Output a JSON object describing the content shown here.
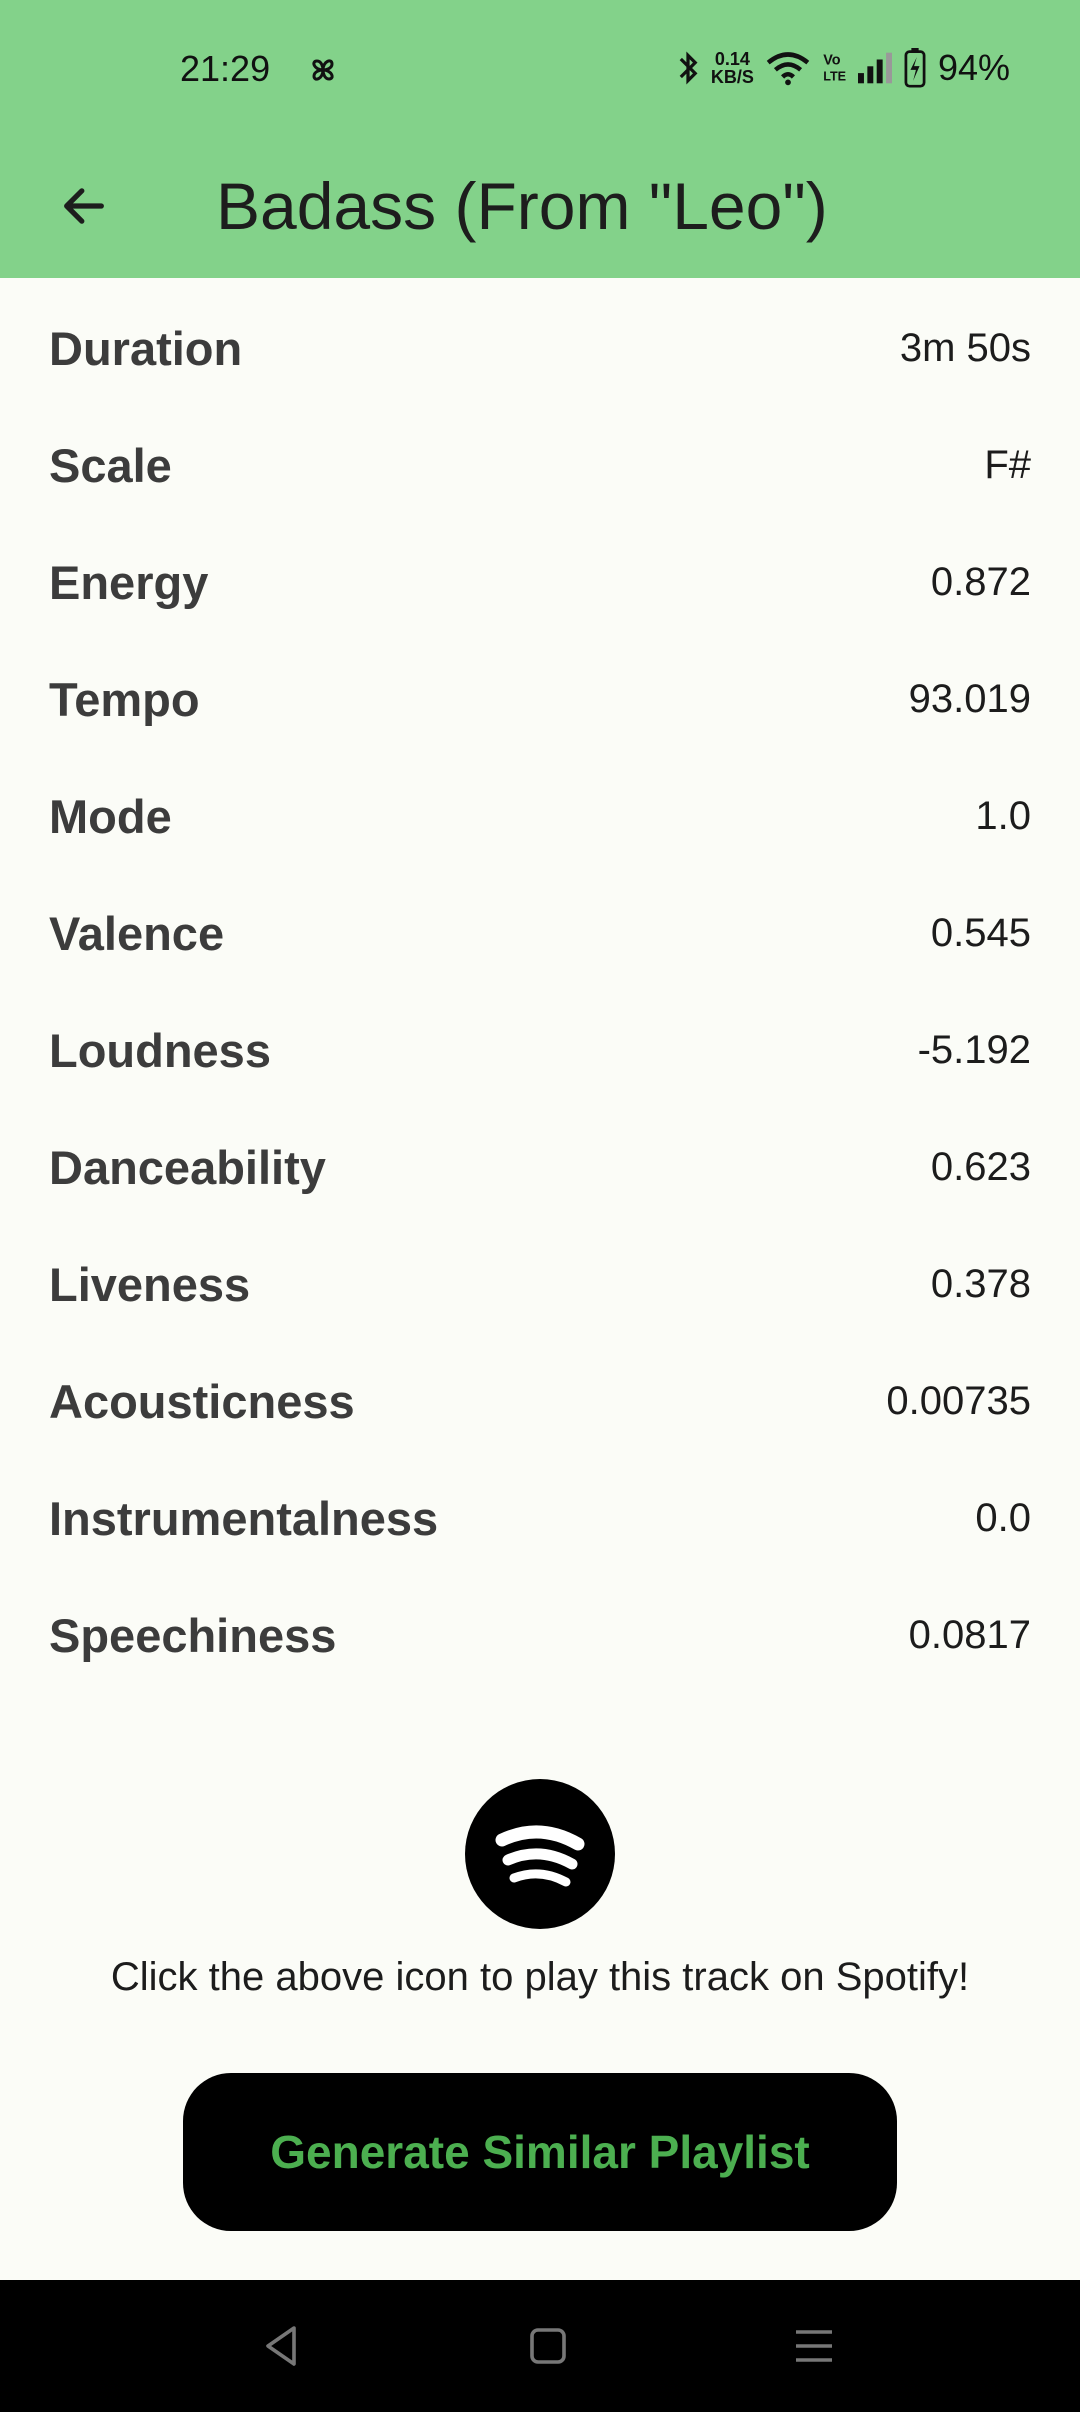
{
  "status_bar": {
    "time": "21:29",
    "net_speed_value": "0.14",
    "net_speed_unit": "KB/S",
    "battery": "94%",
    "icons": [
      "pinwheel-icon",
      "bluetooth-icon",
      "wifi-icon",
      "volte-icon",
      "signal-icon",
      "battery-icon"
    ]
  },
  "app_bar": {
    "title": "Badass (From \"Leo\")",
    "back_icon": "arrow-back-icon"
  },
  "features": [
    {
      "label": "Duration",
      "value": "3m 50s"
    },
    {
      "label": "Scale",
      "value": "F#"
    },
    {
      "label": "Energy",
      "value": "0.872"
    },
    {
      "label": "Tempo",
      "value": "93.019"
    },
    {
      "label": "Mode",
      "value": "1.0"
    },
    {
      "label": "Valence",
      "value": "0.545"
    },
    {
      "label": "Loudness",
      "value": "-5.192"
    },
    {
      "label": "Danceability",
      "value": "0.623"
    },
    {
      "label": "Liveness",
      "value": "0.378"
    },
    {
      "label": "Acousticness",
      "value": "0.00735"
    },
    {
      "label": "Instrumentalness",
      "value": "0.0"
    },
    {
      "label": "Speechiness",
      "value": "0.0817"
    }
  ],
  "spotify": {
    "icon": "spotify-icon",
    "hint": "Click the above icon to play this track on Spotify!"
  },
  "generate_button": {
    "label": "Generate Similar Playlist"
  },
  "nav_bar": {
    "icons": [
      "back-triangle-icon",
      "home-square-icon",
      "menu-lines-icon"
    ]
  },
  "colors": {
    "app_bar": "#83d28a",
    "background": "#fbfcf7",
    "button_text": "#4caf50"
  }
}
